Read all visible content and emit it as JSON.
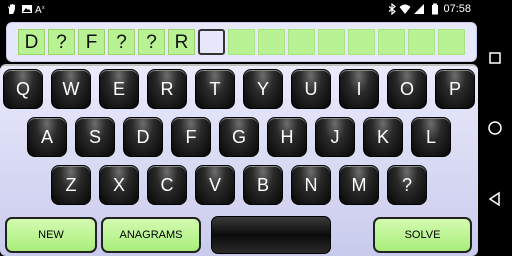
{
  "status_bar": {
    "time": "07:58",
    "left_icons": [
      "hand-icon",
      "image-icon",
      "text-a-icon"
    ],
    "right_icons": [
      "bluetooth-icon",
      "wifi-icon",
      "signal-icon",
      "battery-icon"
    ]
  },
  "word": {
    "tiles": [
      "D",
      "?",
      "F",
      "?",
      "?",
      "R",
      "",
      "",
      "",
      "",
      "",
      "",
      "",
      "",
      ""
    ],
    "cursor_index": 6
  },
  "keyboard": {
    "row1": [
      "Q",
      "W",
      "E",
      "R",
      "T",
      "Y",
      "U",
      "I",
      "O",
      "P"
    ],
    "row2": [
      "A",
      "S",
      "D",
      "F",
      "G",
      "H",
      "J",
      "K",
      "L"
    ],
    "row3": [
      "Z",
      "X",
      "C",
      "V",
      "B",
      "N",
      "M",
      "?"
    ]
  },
  "actions": {
    "new_label": "NEW",
    "anagrams_label": "ANAGRAMS",
    "solve_label": "SOLVE"
  },
  "colors": {
    "tile_green": "#b9f292",
    "panel_bg": "#e6e7fb",
    "key_black": "#0a0a0a"
  },
  "nav_bar": {
    "icons": [
      "recents-square-icon",
      "home-circle-icon",
      "back-triangle-icon"
    ]
  }
}
